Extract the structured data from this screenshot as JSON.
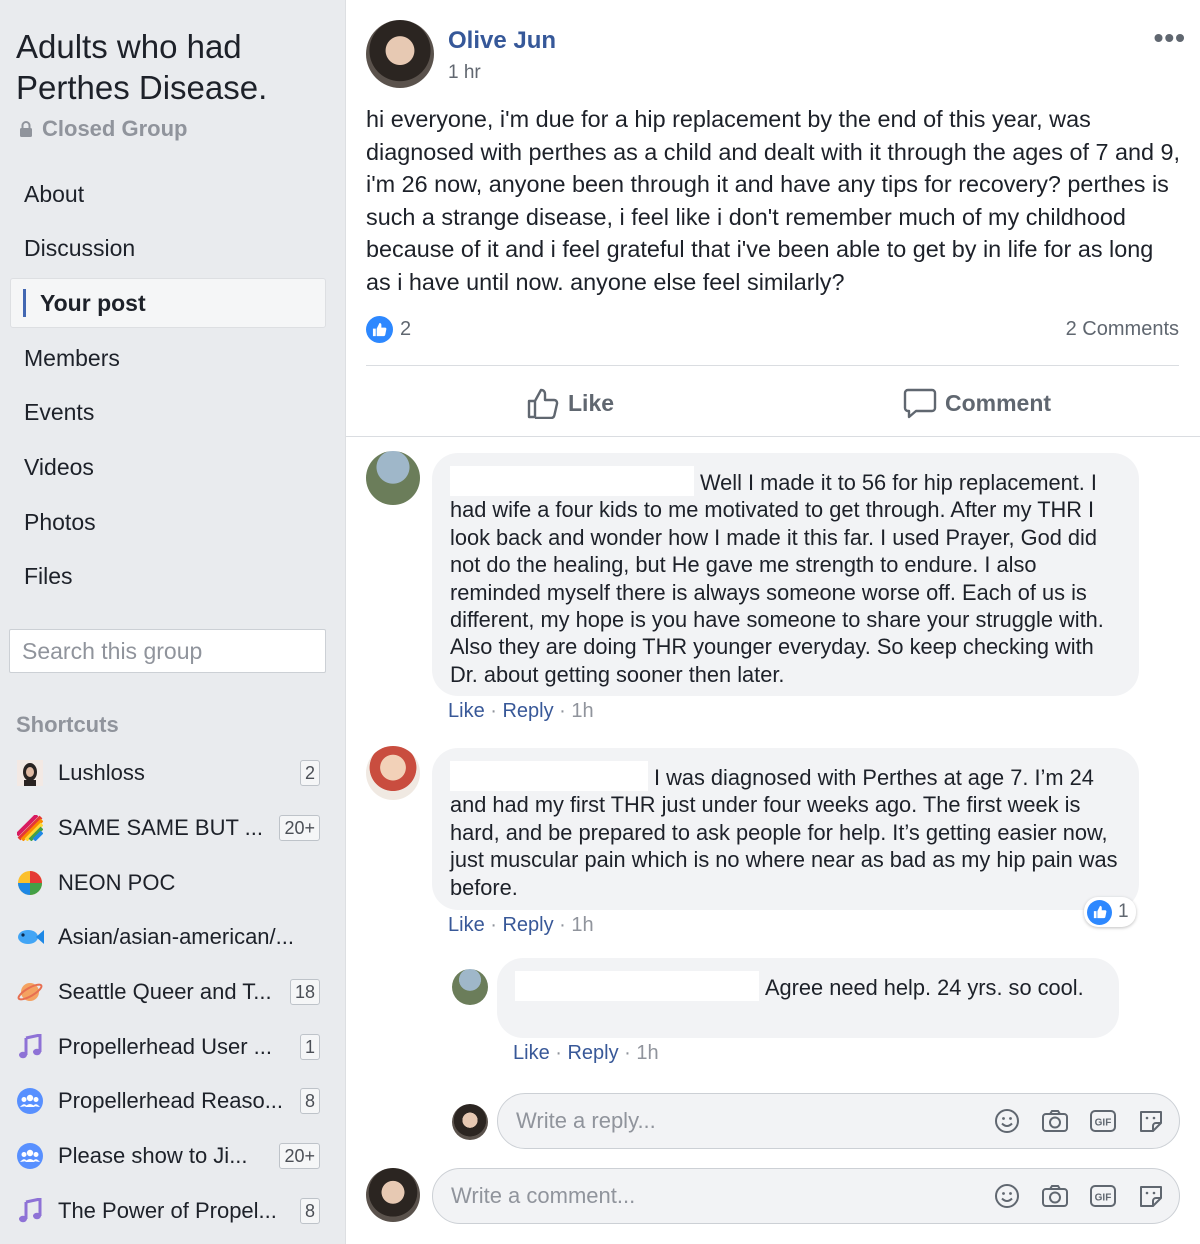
{
  "group": {
    "title": "Adults who had Perthes Disease.",
    "privacy": "Closed Group"
  },
  "nav": {
    "items": [
      {
        "label": "About"
      },
      {
        "label": "Discussion"
      },
      {
        "label": "Your post",
        "active": true
      },
      {
        "label": "Members"
      },
      {
        "label": "Events"
      },
      {
        "label": "Videos"
      },
      {
        "label": "Photos"
      },
      {
        "label": "Files"
      }
    ]
  },
  "search": {
    "placeholder": "Search this group"
  },
  "shortcuts": {
    "title": "Shortcuts",
    "items": [
      {
        "label": "Lushloss",
        "badge": "2",
        "icon": "profile-photo-icon"
      },
      {
        "label": "SAME SAME BUT ...",
        "badge": "20+",
        "icon": "rainbow-icon"
      },
      {
        "label": "NEON POC",
        "badge": "",
        "icon": "pie-icon"
      },
      {
        "label": "Asian/asian-american/...",
        "badge": "",
        "icon": "fish-icon"
      },
      {
        "label": "Seattle Queer and T...",
        "badge": "18",
        "icon": "planet-icon"
      },
      {
        "label": "Propellerhead User ...",
        "badge": "1",
        "icon": "music-note-icon"
      },
      {
        "label": "Propellerhead Reaso...",
        "badge": "8",
        "icon": "group-icon"
      },
      {
        "label": "Please show to Ji...",
        "badge": "20+",
        "icon": "group-icon"
      },
      {
        "label": "The Power of Propel...",
        "badge": "8",
        "icon": "music-note-icon"
      }
    ]
  },
  "post": {
    "author": "Olive Jun",
    "time": "1 hr",
    "more": "•••",
    "text": "hi everyone, i'm due for a hip replacement by the end of this year, was diagnosed with perthes as a child and dealt with it through the ages of 7 and 9, i'm 26 now, anyone been through it and have any tips for recovery? perthes is such a strange disease, i feel like i don't remember much of my childhood because of it and i feel grateful that i've been able to get by in life for as long as i have until now. anyone else feel similarly?",
    "like_count": "2",
    "comments_count": "2 Comments",
    "like_label": "Like",
    "comment_label": "Comment"
  },
  "comments": [
    {
      "text": "Well I made it to 56 for hip replacement. I had wife a four kids to me motivated to get through. After my THR I look back and wonder how I made it this far. I used Prayer, God did not do the healing, but He gave me strength to endure. I also reminded myself there is always someone worse off. Each of us is different, my hope is you have someone to share your struggle with. Also they are doing THR younger everyday. So keep checking with Dr. about getting sooner then later.",
      "like": "Like",
      "reply": "Reply",
      "time": "1h"
    },
    {
      "text": "I was diagnosed with Perthes at age 7. I’m 24 and had my first THR just under four weeks ago. The first week is hard, and be prepared to ask people for help. It’s getting easier now, just muscular pain which is no where near as bad as my hip pain was before.",
      "like": "Like",
      "reply": "Reply",
      "time": "1h",
      "reactions": "1"
    }
  ],
  "reply": {
    "text": "Agree need help. 24 yrs. so cool.",
    "like": "Like",
    "reply": "Reply",
    "time": "1h"
  },
  "composers": {
    "reply_placeholder": "Write a reply...",
    "comment_placeholder": "Write a comment..."
  },
  "colors": {
    "link": "#365899",
    "like_blue": "#2d88ff",
    "nav_accent": "#4267b2"
  }
}
